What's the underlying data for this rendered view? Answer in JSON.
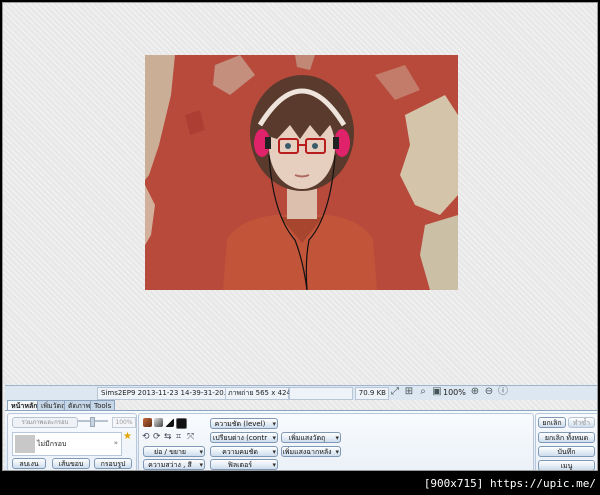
{
  "statusbar": {
    "filename": "Sims2EP9 2013-11-23 14-39-31-20.jpg",
    "image_size": "ภาพถ่าย 565 x 424",
    "file_size": "70.9 KB",
    "zoom": "100%"
  },
  "tabs": [
    {
      "label": "หน้าหลัก"
    },
    {
      "label": "เพิ่มวัตถุ"
    },
    {
      "label": "ตัดภาพ"
    },
    {
      "label": "Tools"
    }
  ],
  "left_group": {
    "merge_label": "รวมภาพและกรอบ",
    "opacity": "100%",
    "frame_label": "ไม่มีกรอบ",
    "delete_label": "ลบเงน",
    "add_frame_label": "เส้นขอบ",
    "crop_frame_label": "กรอบรูป"
  },
  "adjust": {
    "resize_label": "ย่อ / ขยาย",
    "brightness_color_label": "ความสว่าง , สี",
    "sharpness_label": "ความคมชัด",
    "level_label": "ความชัด (level)",
    "contrast_label": "เปรียบต่าง (contr",
    "filter_label": "ฟิลเตอร์",
    "add_object_label": "เพิ่มแสงวัตถุ",
    "add_background_label": "เพิ่มแสงฉากหลัง"
  },
  "right_group": {
    "undo_label": "ยกเลิก",
    "redo_label": "ทำซ้ำ",
    "undo_all_label": "ยกเลิก ทั้งหมด",
    "save_label": "บันทึก",
    "menu_label": "เมนู"
  },
  "watermark": "[900x715] https://upic.me/",
  "colors": {
    "panel_border": "#8aa3bf",
    "headphones": "#e0226a",
    "shirt": "#c2543a",
    "wall": "#b84a3c"
  }
}
